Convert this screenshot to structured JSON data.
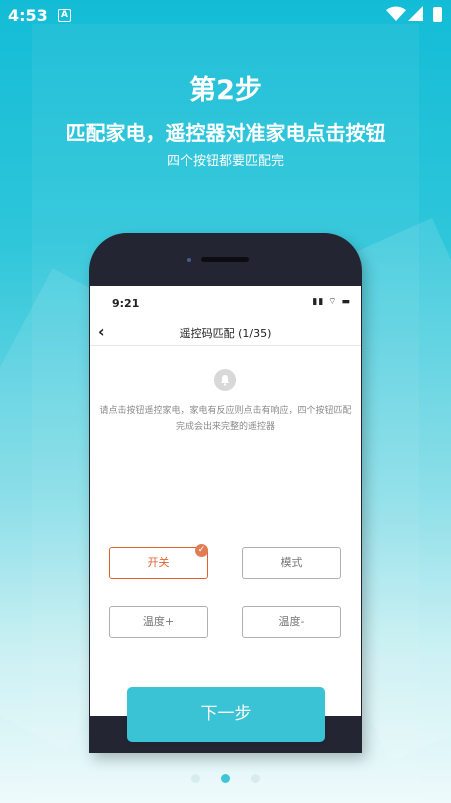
{
  "status_bar": {
    "time": "4:53",
    "notification_icon": "A",
    "icons": [
      "wifi-icon",
      "signal-icon",
      "battery-icon"
    ]
  },
  "header": {
    "step_title": "第2步",
    "headline": "匹配家电，遥控器对准家电点击按钮",
    "subline": "四个按钮都要匹配完"
  },
  "phone_screen": {
    "time": "9:21",
    "status_icons": "▮▮ ⌔ ▬",
    "back_icon": "‹",
    "title": "遥控码匹配 (1/35)",
    "bell_icon": "🔔",
    "instruction": "请点击按钮遥控家电，家电有反应则点击有响应，四个按钮匹配完成会出来完整的遥控器",
    "buttons": [
      {
        "label": "开关",
        "active": true
      },
      {
        "label": "模式",
        "active": false
      },
      {
        "label": "温度+",
        "active": false
      },
      {
        "label": "温度-",
        "active": false
      }
    ],
    "check_mark": "✓"
  },
  "footer": {
    "next_label": "下一步",
    "pages": 3,
    "current_page": 2
  },
  "colors": {
    "accent": "#39c3d5",
    "active_button": "#e0632e"
  }
}
